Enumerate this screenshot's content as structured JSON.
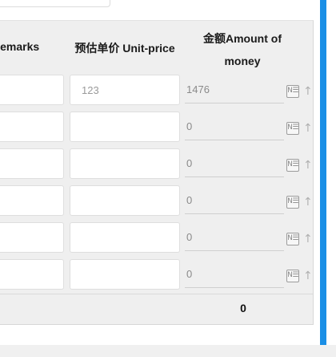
{
  "header": {
    "remarks": "Remarks",
    "unit_price": "预估单价 Unit-price",
    "amount_line1": "金额Amount of",
    "amount_line2": "money"
  },
  "rows": [
    {
      "remarks": "",
      "unit_price": "123",
      "amount": "1476"
    },
    {
      "remarks": "",
      "unit_price": "",
      "amount": "0"
    },
    {
      "remarks": "",
      "unit_price": "",
      "amount": "0"
    },
    {
      "remarks": "",
      "unit_price": "",
      "amount": "0"
    },
    {
      "remarks": "",
      "unit_price": "",
      "amount": "0"
    },
    {
      "remarks": "",
      "unit_price": "",
      "amount": "0"
    }
  ],
  "icons": {
    "calculator_glyph": "N☰",
    "sort_arrow_glyph": "↑"
  },
  "total": "0",
  "colors": {
    "accent_bar": "#1a8fe6",
    "table_background": "#efefef"
  }
}
